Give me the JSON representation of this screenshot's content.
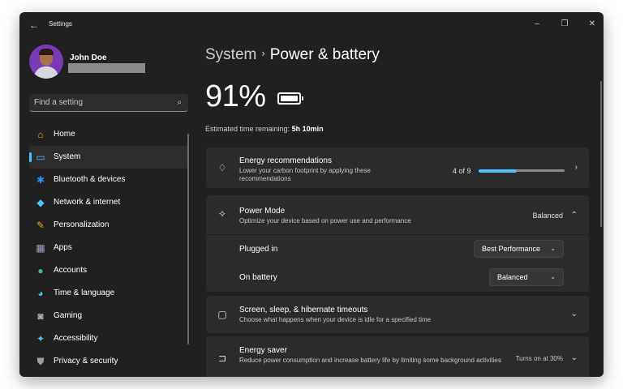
{
  "window": {
    "title": "Settings",
    "back_glyph": "←",
    "minimize_glyph": "–",
    "maximize_glyph": "❐",
    "close_glyph": "✕"
  },
  "user": {
    "name": "John Doe"
  },
  "search": {
    "placeholder": "Find a setting",
    "icon": "search-icon"
  },
  "sidebar": {
    "items": [
      {
        "label": "Home",
        "icon": "home-icon",
        "glyph": "⌂",
        "color": "#f0a030"
      },
      {
        "label": "System",
        "icon": "system-icon",
        "glyph": "▭",
        "color": "#4cc2ff",
        "active": true
      },
      {
        "label": "Bluetooth & devices",
        "icon": "bluetooth-icon",
        "glyph": "✱",
        "color": "#2f8cff"
      },
      {
        "label": "Network & internet",
        "icon": "wifi-icon",
        "glyph": "◆",
        "color": "#4cc2ff"
      },
      {
        "label": "Personalization",
        "icon": "brush-icon",
        "glyph": "✎",
        "color": "#f0a030"
      },
      {
        "label": "Apps",
        "icon": "apps-icon",
        "glyph": "▦",
        "color": "#9aa8c0"
      },
      {
        "label": "Accounts",
        "icon": "accounts-icon",
        "glyph": "●",
        "color": "#3cc07a"
      },
      {
        "label": "Time & language",
        "icon": "globe-icon",
        "glyph": "◕",
        "color": "#4cc2ff"
      },
      {
        "label": "Gaming",
        "icon": "gamepad-icon",
        "glyph": "◙",
        "color": "#b0b0b0"
      },
      {
        "label": "Accessibility",
        "icon": "accessibility-icon",
        "glyph": "✦",
        "color": "#4cc2ff"
      },
      {
        "label": "Privacy & security",
        "icon": "shield-icon",
        "glyph": "⛊",
        "color": "#a0a0a0"
      }
    ]
  },
  "breadcrumb": {
    "parent": "System",
    "separator": "›",
    "current": "Power & battery"
  },
  "battery": {
    "percent": "91%",
    "level": 0.91,
    "estimate_label": "Estimated time remaining:",
    "estimate_value": "5h 10min"
  },
  "cards": {
    "energy_recommendations": {
      "title": "Energy recommendations",
      "desc": "Lower your carbon footprint by applying these recommendations",
      "progress_text": "4 of 9",
      "progress_fraction": 0.444,
      "icon": "leaf-icon",
      "glyph": "♢",
      "chevron": "›"
    },
    "power_mode": {
      "title": "Power Mode",
      "desc": "Optimize your device based on power use and performance",
      "value": "Balanced",
      "icon": "power-mode-icon",
      "glyph": "✧",
      "chevron": "⌃",
      "plugged_in": {
        "label": "Plugged in",
        "value": "Best Performance"
      },
      "on_battery": {
        "label": "On battery",
        "value": "Balanced"
      },
      "select_chevron": "⌄"
    },
    "screen_sleep": {
      "title": "Screen, sleep, & hibernate timeouts",
      "desc": "Choose what happens when your device is idle for a specified time",
      "icon": "screen-sleep-icon",
      "glyph": "▢",
      "chevron": "⌄"
    },
    "energy_saver": {
      "title": "Energy saver",
      "desc": "Reduce power consumption and increase battery life by limiting some background activities",
      "value": "Turns on at 30%",
      "icon": "energy-saver-icon",
      "glyph": "⊐",
      "chevron": "⌄"
    }
  },
  "colors": {
    "accent": "#4cc2ff",
    "window_bg": "#202020",
    "card_bg": "#2b2b2b"
  }
}
